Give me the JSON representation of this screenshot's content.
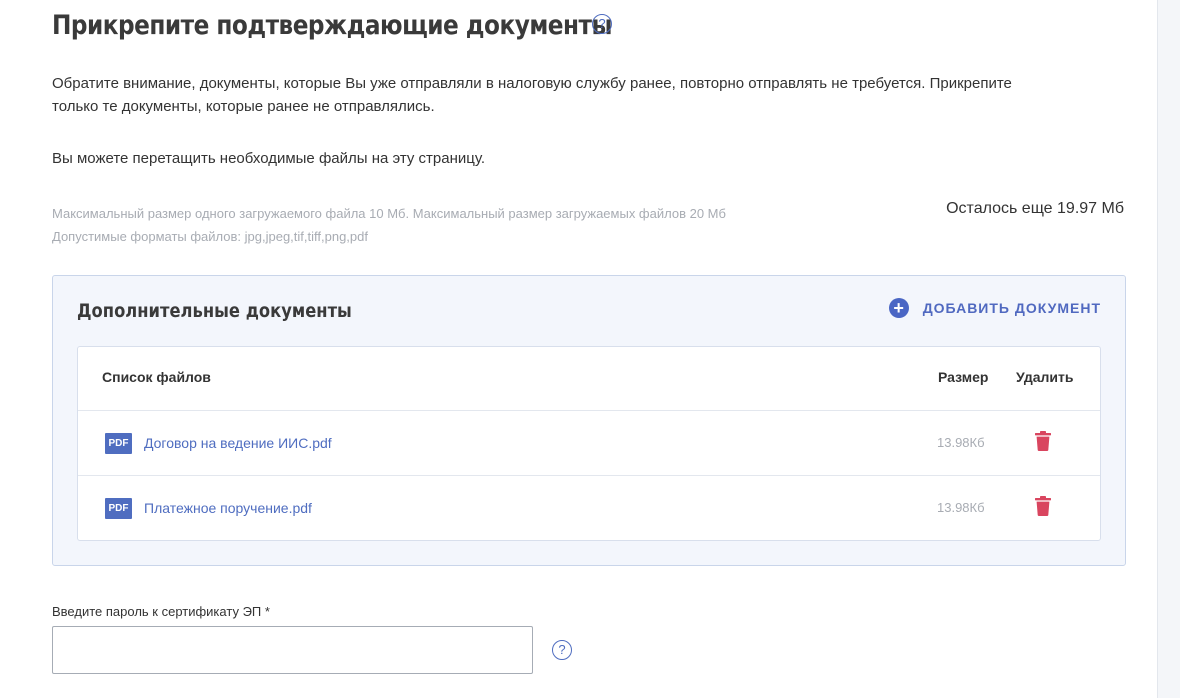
{
  "page": {
    "title": "Прикрепите подтверждающие документы",
    "help_icon": "?",
    "note_lines": [
      "Обратите внимание, документы, которые Вы уже отправляли в налоговую службу ранее, повторно отправлять не требуется. Прикрепите",
      "только те документы, которые ранее не отправлялись."
    ],
    "drag_note": "Вы можете перетащить необходимые файлы на эту страницу.",
    "limit_size": "Максимальный размер одного загружаемого файла 10 Мб. Максимальный размер загружаемых файлов 20 Мб",
    "limit_formats": "Допустимые форматы файлов: jpg,jpeg,tif,tiff,png,pdf",
    "remaining": "Осталось еще 19.97 Мб"
  },
  "docs_panel": {
    "title": "Дополнительные документы",
    "add_icon": "+",
    "add_label": "ДОБАВИТЬ ДОКУМЕНТ",
    "table": {
      "col_name": "Список файлов",
      "col_size": "Размер",
      "col_delete": "Удалить",
      "rows": [
        {
          "icon": "PDF",
          "name": "Договор на ведение ИИС.pdf",
          "size": "13.98Кб"
        },
        {
          "icon": "PDF",
          "name": "Платежное поручение.pdf",
          "size": "13.98Кб"
        }
      ]
    }
  },
  "password": {
    "label": "Введите пароль к сертификату ЭП *",
    "value": "",
    "help_icon": "?"
  },
  "colors": {
    "accent": "#4f6dc0",
    "delete": "#d9455f",
    "panel_bg": "#f3f6fc",
    "muted_text": "#a8acb3"
  },
  "icons": {
    "title_help": "help-circle-icon",
    "add": "plus-circle-icon",
    "file": "pdf-file-icon",
    "delete": "trash-icon",
    "password_help": "help-circle-icon"
  }
}
